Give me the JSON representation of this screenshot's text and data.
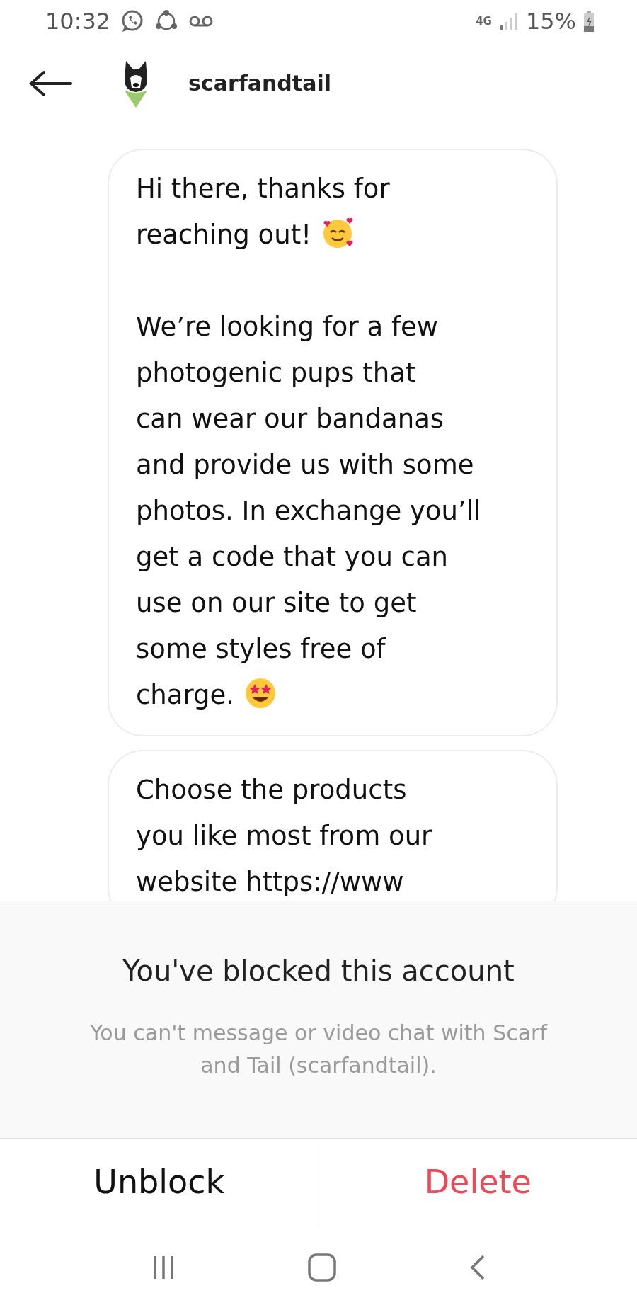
{
  "status_bar": {
    "time": "10:32",
    "network": "4G",
    "battery": "15%"
  },
  "header": {
    "username": "scarfandtail"
  },
  "messages": [
    {
      "paragraphs": [
        {
          "text": "Hi there, thanks for\nreaching out!",
          "emoji": {
            "kind": "hearts"
          }
        },
        {
          "text": "We’re looking for a few\nphotogenic pups that\ncan wear our bandanas\nand provide us with some\nphotos. In exchange you’ll\nget a code that you can\nuse on our site to get\nsome styles free of\ncharge.",
          "emoji": {
            "kind": "stars"
          }
        }
      ]
    },
    {
      "paragraphs": [
        {
          "text": "Choose the products\nyou like most from our\nwebsite https://www"
        }
      ]
    }
  ],
  "blocked_panel": {
    "title": "You've blocked this account",
    "description": "You can't message or video chat with Scarf\nand Tail (scarfandtail)."
  },
  "actions": [
    {
      "label": "Unblock",
      "kind": "neutral"
    },
    {
      "label": "Delete",
      "kind": "destructive"
    }
  ]
}
